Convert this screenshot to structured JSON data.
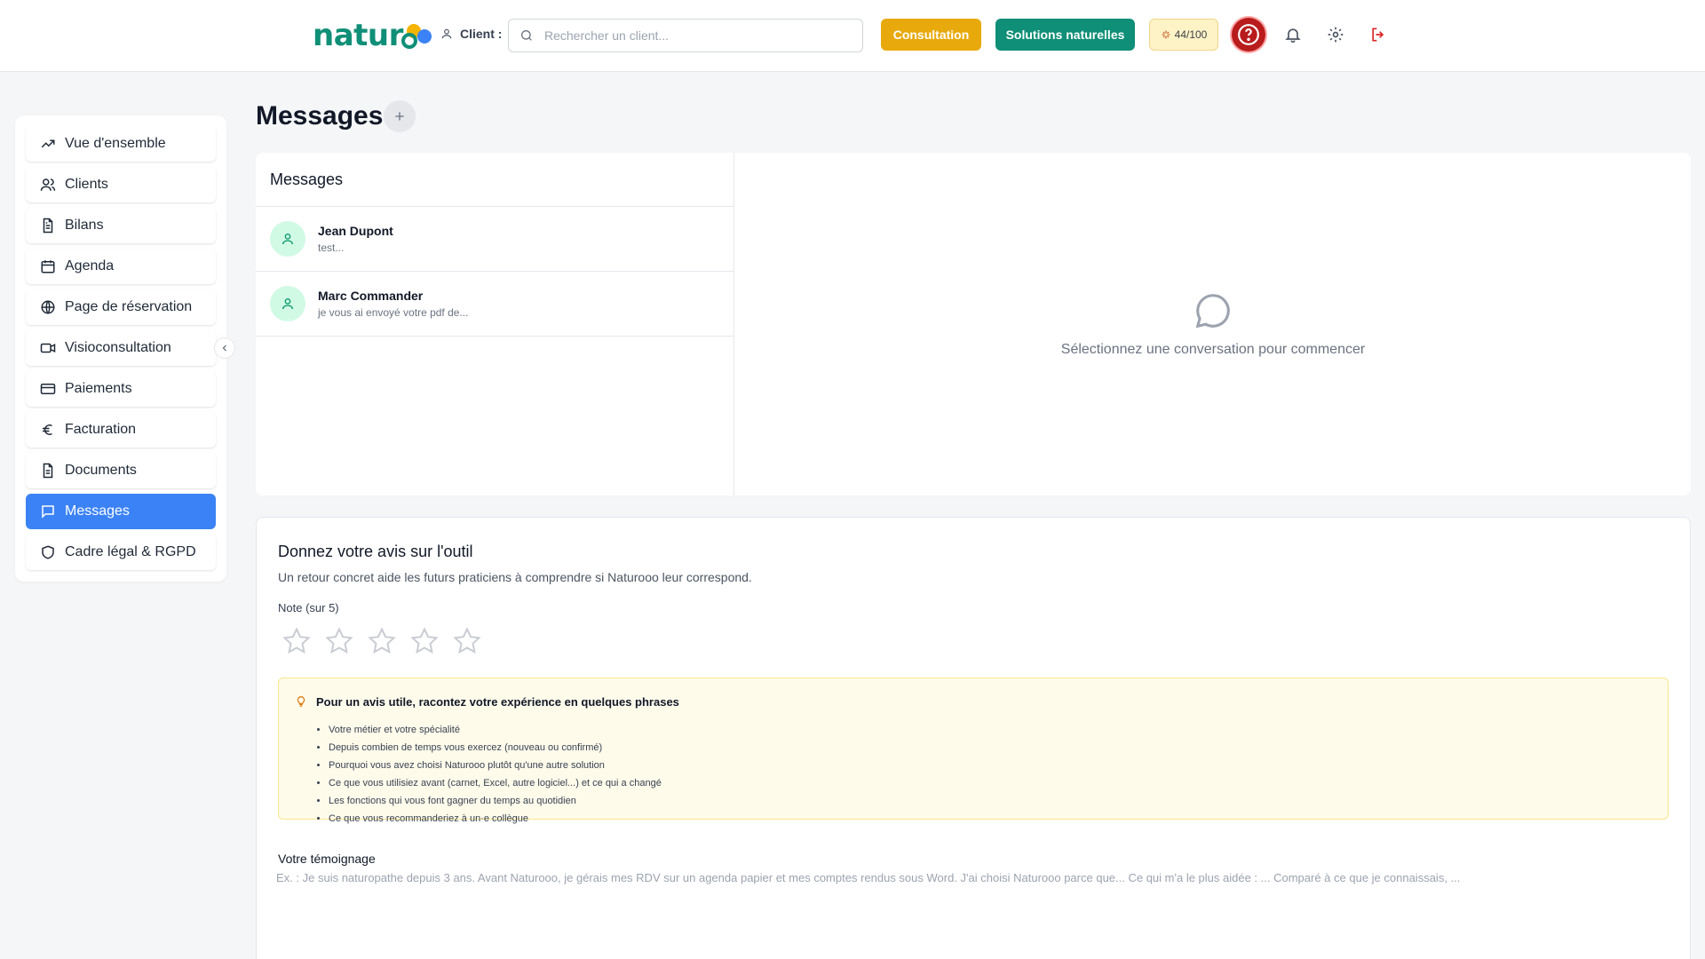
{
  "header": {
    "logo_text": "natur",
    "client_label": "Client :",
    "search_placeholder": "Rechercher un client...",
    "consultation_label": "Consultation",
    "solutions_label": "Solutions naturelles",
    "score": "44/100",
    "help_icon": "help-circle-icon",
    "icons": [
      "bell-icon",
      "gear-icon",
      "logout-icon"
    ],
    "colors": {
      "brand": "#0f8f77",
      "accent": "#e8a90c",
      "help": "#b91c1c"
    }
  },
  "sidebar": {
    "items": [
      {
        "label": "Vue d'ensemble",
        "icon": "trending-up-icon",
        "active": false
      },
      {
        "label": "Clients",
        "icon": "users-icon",
        "active": false
      },
      {
        "label": "Bilans",
        "icon": "file-text-icon",
        "active": false
      },
      {
        "label": "Agenda",
        "icon": "calendar-icon",
        "active": false
      },
      {
        "label": "Page de réservation",
        "icon": "globe-icon",
        "active": false
      },
      {
        "label": "Visioconsultation",
        "icon": "video-icon",
        "active": false
      },
      {
        "label": "Paiements",
        "icon": "credit-card-icon",
        "active": false
      },
      {
        "label": "Facturation",
        "icon": "euro-icon",
        "active": false
      },
      {
        "label": "Documents",
        "icon": "file-icon",
        "active": false
      },
      {
        "label": "Messages",
        "icon": "message-icon",
        "active": true
      },
      {
        "label": "Cadre légal & RGPD",
        "icon": "shield-icon",
        "active": false
      }
    ],
    "active_color": "#3b82f6"
  },
  "main": {
    "title": "Messages",
    "messages": {
      "list_title": "Messages",
      "conversations": [
        {
          "name": "Jean Dupont",
          "preview": "test..."
        },
        {
          "name": "Marc Commander",
          "preview": "je vous ai envoyé votre pdf de..."
        }
      ],
      "empty_text": "Sélectionnez une conversation pour commencer"
    },
    "feedback": {
      "title": "Donnez votre avis sur l'outil",
      "subtitle": "Un retour concret aide les futurs praticiens à comprendre si Naturooo leur correspond.",
      "rating_label": "Note (sur 5)",
      "rating_value": 0,
      "rating_max": 5,
      "tips_title": "Pour un avis utile, racontez votre expérience en quelques phrases",
      "tips": [
        "Votre métier et votre spécialité",
        "Depuis combien de temps vous exercez (nouveau ou confirmé)",
        "Pourquoi vous avez choisi Naturooo plutôt qu'une autre solution",
        "Ce que vous utilisiez avant (carnet, Excel, autre logiciel...) et ce qui a changé",
        "Les fonctions qui vous font gagner du temps au quotidien",
        "Ce que vous recommanderiez à un·e collègue"
      ],
      "testimony_label": "Votre témoignage",
      "testimony_placeholder": "Ex. : Je suis naturopathe depuis 3 ans. Avant Naturooo, je gérais mes RDV sur un agenda papier et mes comptes rendus sous Word. J'ai choisi Naturooo parce que... Ce qui m'a le plus aidée : ... Comparé à ce que je connaissais, ..."
    }
  }
}
